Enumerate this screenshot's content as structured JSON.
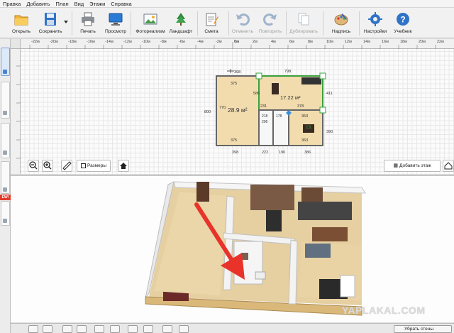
{
  "menu": [
    "Правка",
    "Добавить",
    "План",
    "Вид",
    "Этажи",
    "Справка"
  ],
  "toolbar": {
    "open": "Открыть",
    "save": "Сохранить",
    "print": "Печать",
    "preview": "Просмотр",
    "photo": "Фотореализм",
    "landscape": "Ландшафт",
    "estimate": "Смета",
    "undo": "Отменить",
    "redo": "Повторить",
    "duplicate": "Дублировать",
    "labels": "Надпись",
    "settings": "Настройки",
    "tutorial": "Учебник"
  },
  "ruler": {
    "origin": "0м",
    "ticks_neg": [
      "-22м",
      "-20м",
      "-18м",
      "-16м",
      "-14м",
      "-12м",
      "-10м",
      "-8м",
      "-6м",
      "-4м",
      "-2м"
    ],
    "ticks_pos": [
      "2м",
      "4м",
      "6м",
      "8м",
      "10м",
      "12м",
      "14м",
      "16м",
      "18м",
      "20м",
      "22м",
      "24м"
    ]
  },
  "plan": {
    "dims_top": [
      "398",
      "798"
    ],
    "dims_bottom": [
      "398",
      "222",
      "190",
      "386"
    ],
    "dims_left": "800",
    "dims_right": [
      "411",
      "390"
    ],
    "room_a": {
      "area": "28.9 м²",
      "w": "375",
      "h": "770"
    },
    "room_b": {
      "area": "17.22 м²",
      "w": "378",
      "h": "586"
    },
    "room_c": {
      "area": "13.",
      "w": "363"
    },
    "room_d": {
      "w": "218"
    },
    "room_e": {
      "w": "206"
    },
    "room_f": {
      "w": "178"
    },
    "room_g": {
      "w": "231"
    },
    "room_h": {
      "w": "363"
    },
    "misc": [
      "375",
      "386",
      "218"
    ]
  },
  "zoombar": {
    "dimensions": "Размеры",
    "add_floor": "Добавить этаж"
  },
  "bottombar": {
    "right_label": "Убрать стены"
  },
  "watermark": "YAPLAKAL.COM",
  "colors": {
    "accent": "#1a73c8",
    "arrow": "#e8322a",
    "floor": "#e9cf9b",
    "wall": "#f3f3f3"
  }
}
